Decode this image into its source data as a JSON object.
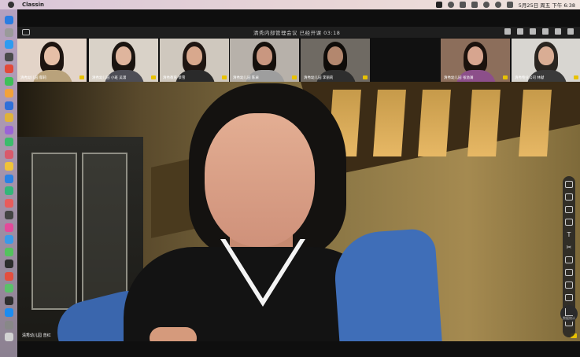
{
  "menubar": {
    "app_name": "Classin",
    "datetime": "5月25日 周五 下午 6:38",
    "apple_icon": "apple-icon",
    "status_icons": [
      "wechat-icon",
      "cloud-icon",
      "bluetooth-icon",
      "battery-icon",
      "wifi-icon",
      "search-icon",
      "control-center-icon"
    ]
  },
  "window": {
    "title": "清秀内部管理会议    已经开课 03:18",
    "layout_icon": "layout-icon",
    "right_icons": [
      "microphone-icon",
      "speaker-icon",
      "camera-icon",
      "grid-icon",
      "expand-icon",
      "close-icon"
    ]
  },
  "thumbnails": [
    {
      "name": "清秀幼儿园 鄢莉",
      "bg": "#e3d4c8",
      "hair": "#1d1410",
      "skin": "#e6bfa7",
      "torso": "#b9a27b"
    },
    {
      "name": "清秀幼儿园 小班 吴潇",
      "bg": "#d9d2c8",
      "hair": "#1a1410",
      "skin": "#dfb59d",
      "torso": "#4d4d55"
    },
    {
      "name": "清秀教育 蔡雪",
      "bg": "#cfc8be",
      "hair": "#1f1612",
      "skin": "#d8a88d",
      "torso": "#2a2a2a"
    },
    {
      "name": "清秀幼儿园 陈卓",
      "bg": "#b7b1aa",
      "hair": "#15100c",
      "skin": "#c99780",
      "torso": "#9e9e9e"
    },
    {
      "name": "清秀幼儿园 李丽莉",
      "bg": "#6f6a63",
      "hair": "#0f0c09",
      "skin": "#b3876e",
      "torso": "#2e2e2e"
    },
    {
      "name": "清秀幼儿园 张溢澜",
      "bg": "#8c6e5b",
      "hair": "#1b120d",
      "skin": "#d7a58f",
      "torso": "#8c4f8a"
    },
    {
      "name": "清秀物业公司 林献",
      "bg": "#d8d6d1",
      "hair": "#2a2520",
      "skin": "#d9ad94",
      "torso": "#3a3a3a"
    }
  ],
  "stage": {
    "name": "清秀幼儿园 曾红"
  },
  "toolbar": {
    "tools": [
      "cursor-icon",
      "select-icon",
      "pen-icon",
      "eraser-icon",
      "text-icon",
      "scissors-icon",
      "camera-tool-icon",
      "cloud-icon",
      "keyboard-icon",
      "document-icon",
      "toggle-icon",
      "person-icon"
    ],
    "text_label": "T"
  },
  "stats_button": {
    "label": "数据统计"
  },
  "dock_colors": [
    "#2a7de1",
    "#9a9a9a",
    "#2e9bf0",
    "#4a4a4a",
    "#e24a3a",
    "#3fbf5a",
    "#f2a23a",
    "#2f6fd8",
    "#e0b23a",
    "#9a64d6",
    "#3dbb6c",
    "#d85a6c",
    "#f0c23a",
    "#2a82e4",
    "#34b67a",
    "#e85c5c",
    "#444444",
    "#e34a9a",
    "#3a9ae8",
    "#54c25e",
    "#2d2d2d",
    "#e34f3f",
    "#5bc06a",
    "#2f2f2f",
    "#1c8cf0",
    "#888888",
    "#d2d2d2"
  ]
}
